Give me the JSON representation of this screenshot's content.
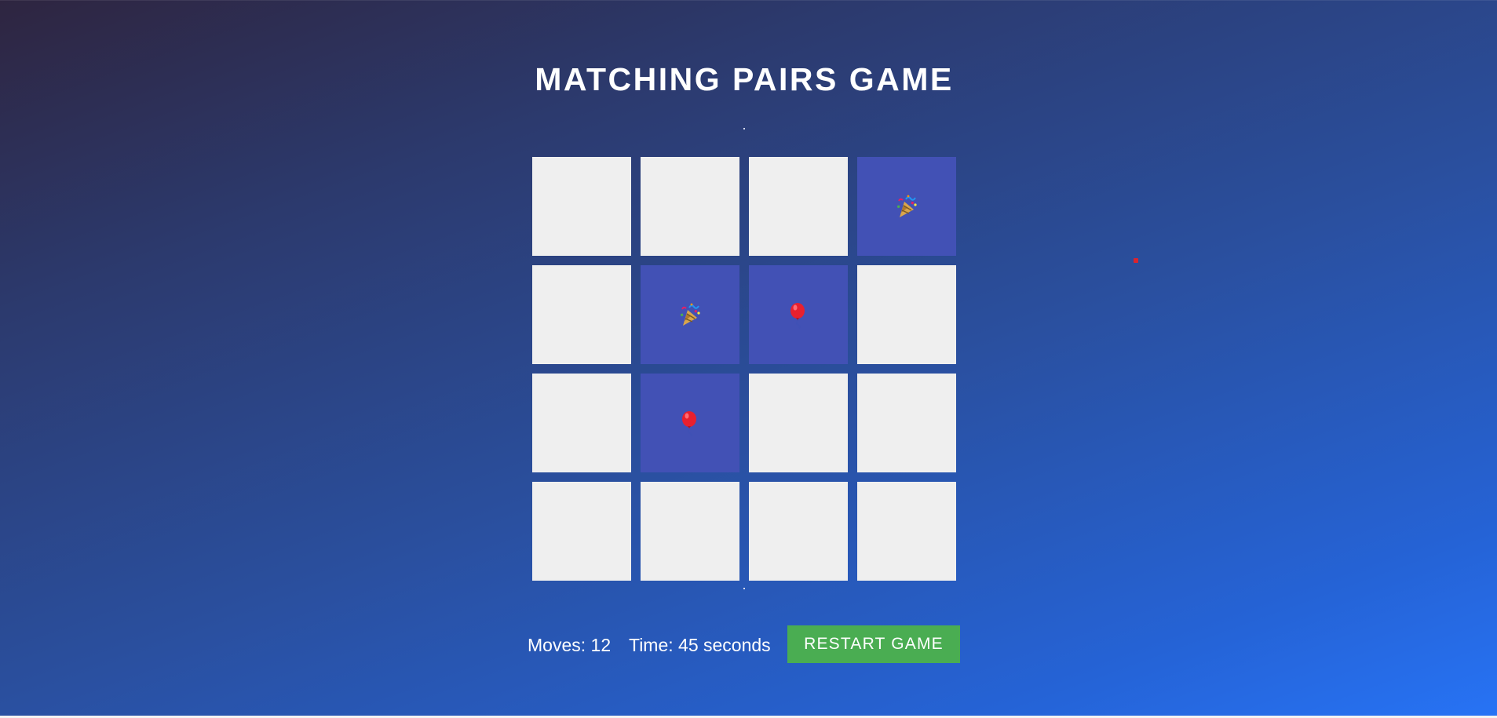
{
  "game": {
    "title": "MATCHING PAIRS GAME"
  },
  "board": {
    "rows": 4,
    "cols": 4,
    "cards": [
      {
        "state": "hidden"
      },
      {
        "state": "hidden"
      },
      {
        "state": "hidden"
      },
      {
        "state": "revealed",
        "icon": "party-popper-icon"
      },
      {
        "state": "hidden"
      },
      {
        "state": "revealed",
        "icon": "party-popper-icon"
      },
      {
        "state": "revealed",
        "icon": "balloon-icon"
      },
      {
        "state": "hidden"
      },
      {
        "state": "hidden"
      },
      {
        "state": "revealed",
        "icon": "balloon-icon"
      },
      {
        "state": "hidden"
      },
      {
        "state": "hidden"
      },
      {
        "state": "hidden"
      },
      {
        "state": "hidden"
      },
      {
        "state": "hidden"
      },
      {
        "state": "hidden"
      }
    ]
  },
  "status": {
    "moves_text": "Moves: 12",
    "time_text": "Time: 45 seconds"
  },
  "controls": {
    "restart_label": "RESTART GAME"
  },
  "colors": {
    "card_hidden": "#efefef",
    "card_revealed": "#4251b5",
    "restart_button": "#4aad52",
    "background_start": "#2e2540",
    "background_end": "#2773f5"
  }
}
